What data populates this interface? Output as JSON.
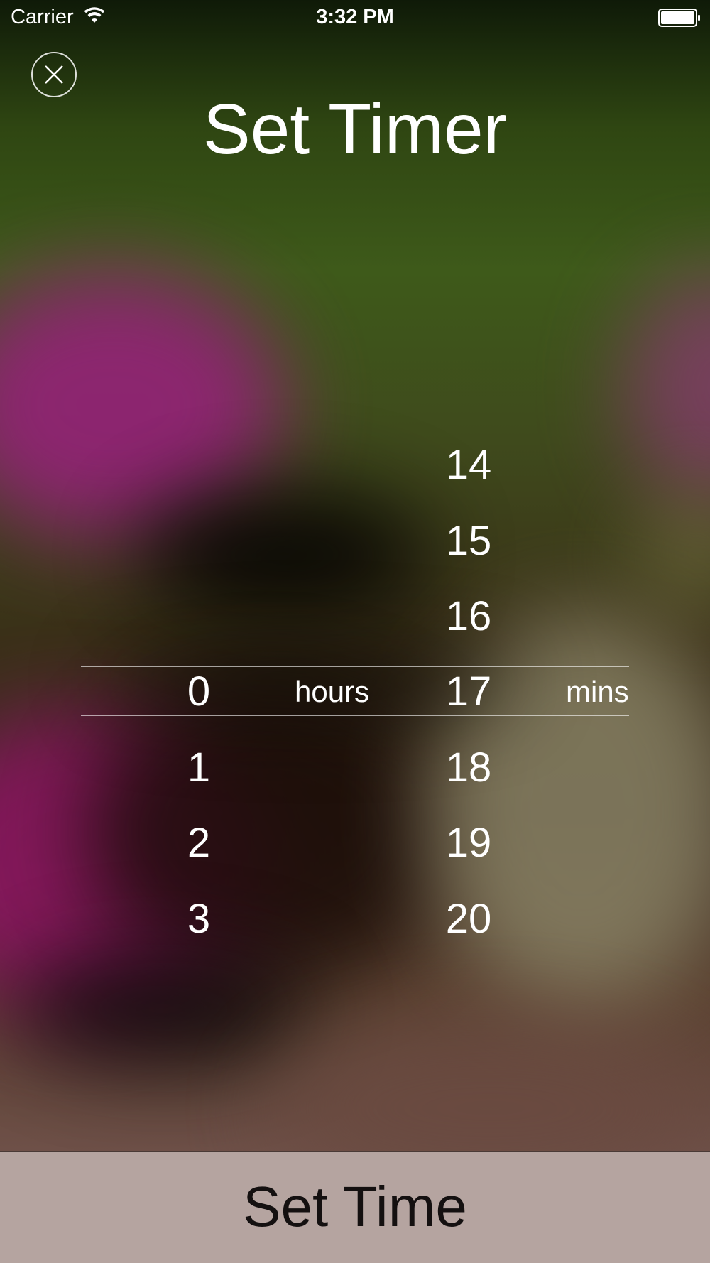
{
  "status_bar": {
    "carrier": "Carrier",
    "time": "3:32 PM",
    "wifi_icon": "wifi-icon",
    "battery_icon": "battery-icon"
  },
  "header": {
    "title": "Set Timer",
    "close_icon": "close-icon"
  },
  "picker": {
    "hours": {
      "unit_label": "hours",
      "selected": "0",
      "values": [
        "",
        "",
        "",
        "0",
        "1",
        "2",
        "3"
      ]
    },
    "minutes": {
      "unit_label": "mins",
      "selected": "17",
      "values": [
        "14",
        "15",
        "16",
        "17",
        "18",
        "19",
        "20"
      ]
    }
  },
  "footer": {
    "set_time_label": "Set Time"
  },
  "colors": {
    "text": "#ffffff",
    "footer_background": "#b5a4a0",
    "footer_text": "#141010",
    "selection_line": "#ffffff"
  }
}
